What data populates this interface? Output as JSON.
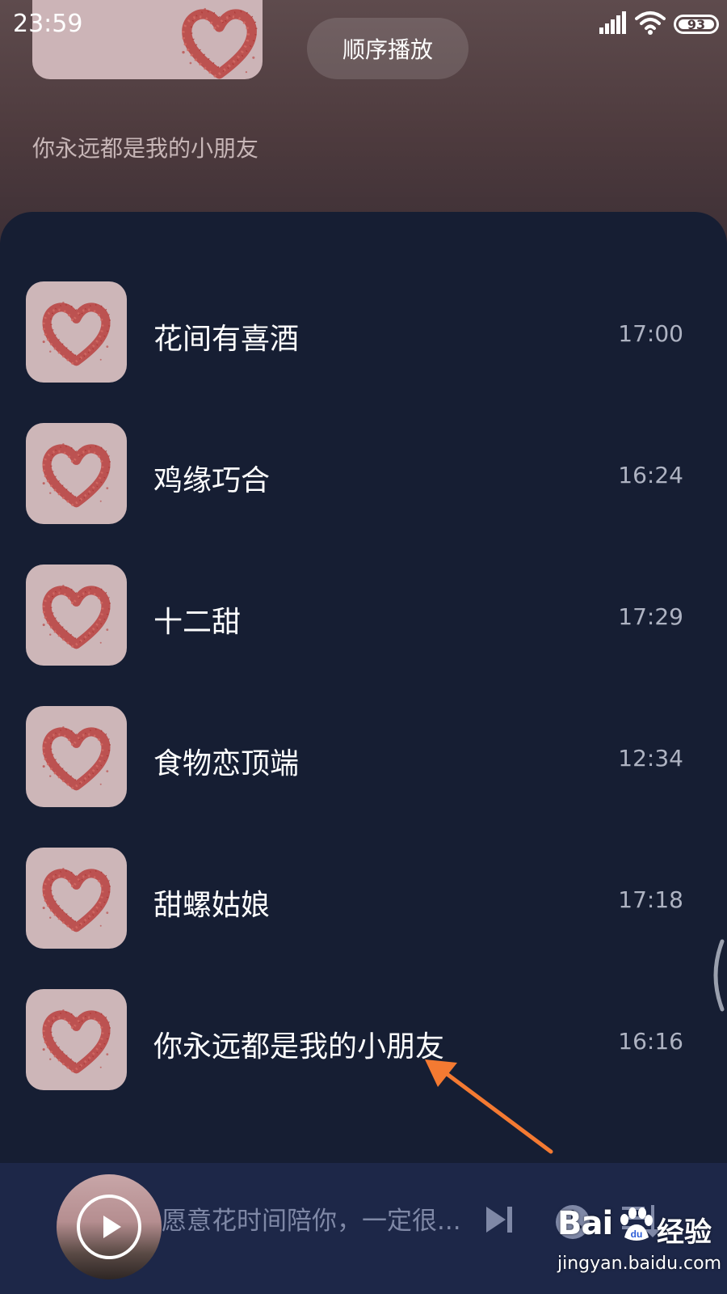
{
  "status_bar": {
    "time": "23:59",
    "battery": "93",
    "signal_icon": "signal-icon",
    "wifi_icon": "wifi-icon"
  },
  "header": {
    "order_button_label": "顺序播放",
    "current_title": "你永远都是我的小朋友"
  },
  "songs": [
    {
      "title": "花间有喜酒",
      "duration": "17:00"
    },
    {
      "title": "鸡缘巧合",
      "duration": "16:24"
    },
    {
      "title": "十二甜",
      "duration": "17:29"
    },
    {
      "title": "食物恋顶端",
      "duration": "12:34"
    },
    {
      "title": "甜螺姑娘",
      "duration": "17:18"
    },
    {
      "title": "你永远都是我的小朋友",
      "duration": "16:16"
    }
  ],
  "mini_player": {
    "lyric": "愿意花时间陪你，一定很...",
    "icons": [
      "play-icon",
      "next-icon",
      "clock-icon",
      "playlist-icon"
    ]
  },
  "watermark": {
    "brand": "Bai",
    "brand_suffix": "经验",
    "url": "jingyan.baidu.com"
  },
  "colors": {
    "sheet_bg": "#161e33",
    "player_bg": "#1d2748",
    "arrow": "#f47a32",
    "heart": "#b8413e"
  }
}
